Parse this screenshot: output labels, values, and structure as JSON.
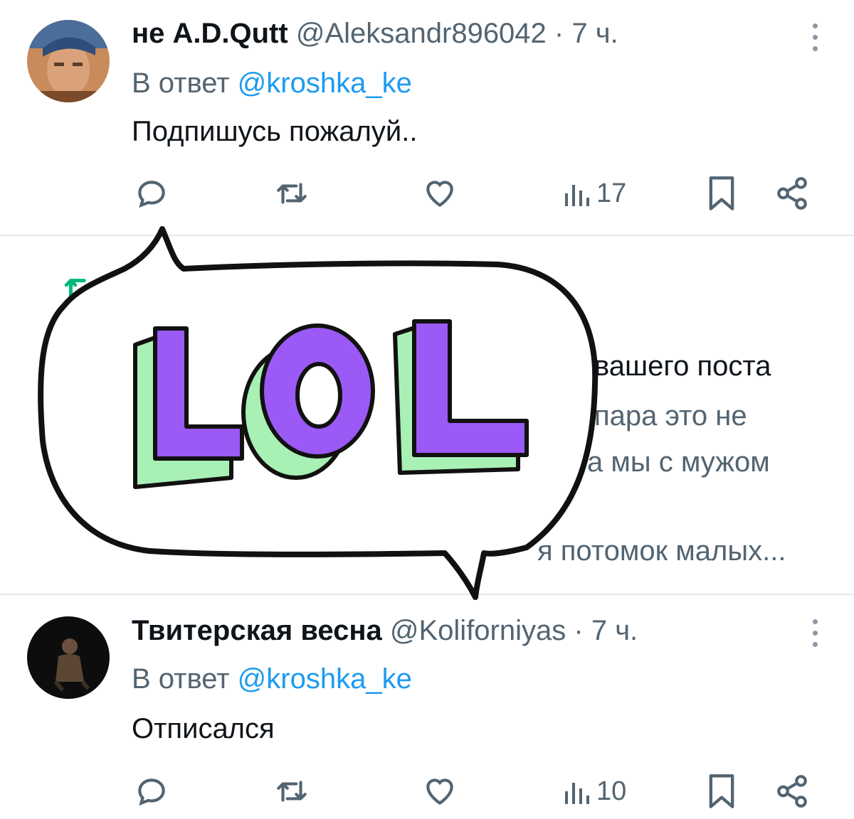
{
  "tweets": [
    {
      "name": "не A.D.Qutt",
      "handle": "@Aleksandr896042",
      "dot": "·",
      "time": "7 ч.",
      "reply_prefix": "В ответ",
      "reply_to": "@kroshka_ke",
      "text": "Подпишусь пожалуй..",
      "views": "17"
    },
    {
      "name": "Твитерская весна",
      "handle": "@Koliforniyas",
      "dot": "·",
      "time": "7 ч.",
      "reply_prefix": "В ответ",
      "reply_to": "@kroshka_ke",
      "text": "Отписался",
      "views": "10"
    }
  ],
  "hidden_tweet": {
    "line1": "вашего поста",
    "line2": "пара это не",
    "line3": "а мы с мужом",
    "line4": "я потомок малых..."
  },
  "sticker": {
    "text": "LOL",
    "colors": {
      "fill": "#9b59f5",
      "shadow": "#a8f0b4",
      "outline": "#111111"
    }
  },
  "icons": [
    "reply-icon",
    "retweet-icon",
    "like-icon",
    "views-icon",
    "bookmark-icon",
    "share-icon",
    "more-icon"
  ],
  "colors": {
    "link": "#1d9bf0",
    "secondary": "#536471",
    "retweet_green": "#00ba7c"
  }
}
